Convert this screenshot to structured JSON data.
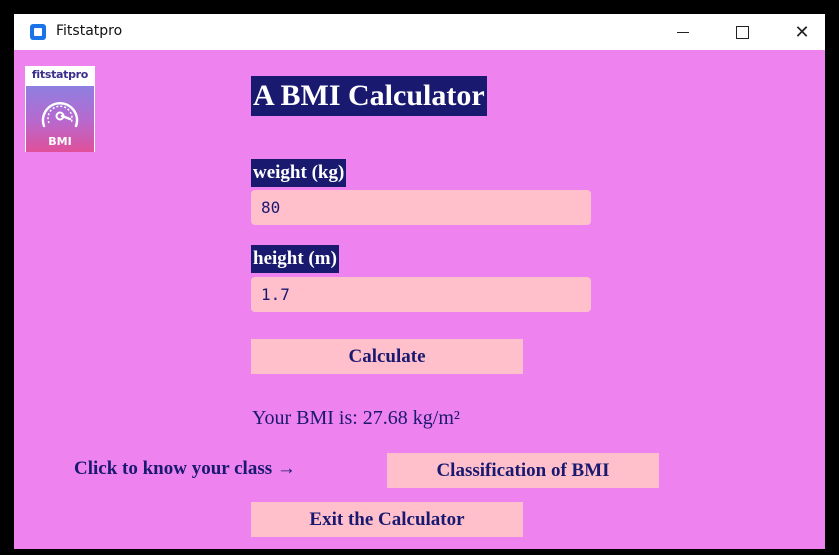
{
  "window": {
    "title": "Fitstatpro",
    "controls": {
      "minimize_icon": "minimize-icon",
      "maximize_icon": "maximize-icon",
      "close_glyph": "✕"
    }
  },
  "logo": {
    "brand_text": "fitstatpro",
    "badge_text": "BMI",
    "icon": "speedometer-icon"
  },
  "main": {
    "heading": "A BMI Calculator",
    "weight_label": "weight (kg)",
    "weight_value": "80",
    "height_label": "height (m)",
    "height_value": "1.7",
    "calculate_label": "Calculate",
    "result_text": "Your BMI is: 27.68 kg/m²",
    "class_prompt": "Click to know your class →",
    "classification_label": "Classification of BMI",
    "exit_label": "Exit the Calculator"
  },
  "colors": {
    "background": "#ee82ee",
    "label_bg": "#191970",
    "button_bg": "#ffc0cb",
    "text_dark": "#191970"
  }
}
